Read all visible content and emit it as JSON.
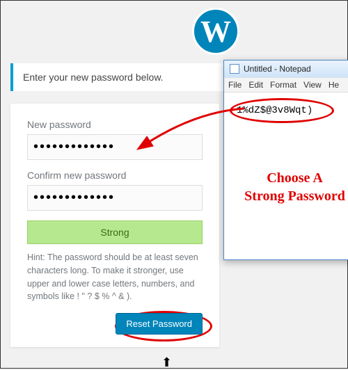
{
  "logo_letter": "W",
  "message": "Enter your new password below.",
  "form": {
    "new_pw_label": "New password",
    "new_pw_value": "●●●●●●●●●●●●●",
    "confirm_pw_label": "Confirm new password",
    "confirm_pw_value": "●●●●●●●●●●●●●",
    "strength": "Strong",
    "hint": "Hint: The password should be at least seven characters long. To make it stronger, use upper and lower case letters, numbers, and symbols like ! \" ? $ % ^ & ).",
    "submit_label": "Reset Password"
  },
  "notepad": {
    "title": "Untitled - Notepad",
    "menu": [
      "File",
      "Edit",
      "Format",
      "View",
      "He"
    ],
    "password_example": "1%dZ$@3v8Wqt)"
  },
  "annotation": {
    "line1": "Choose A",
    "line2": "Strong Password"
  }
}
